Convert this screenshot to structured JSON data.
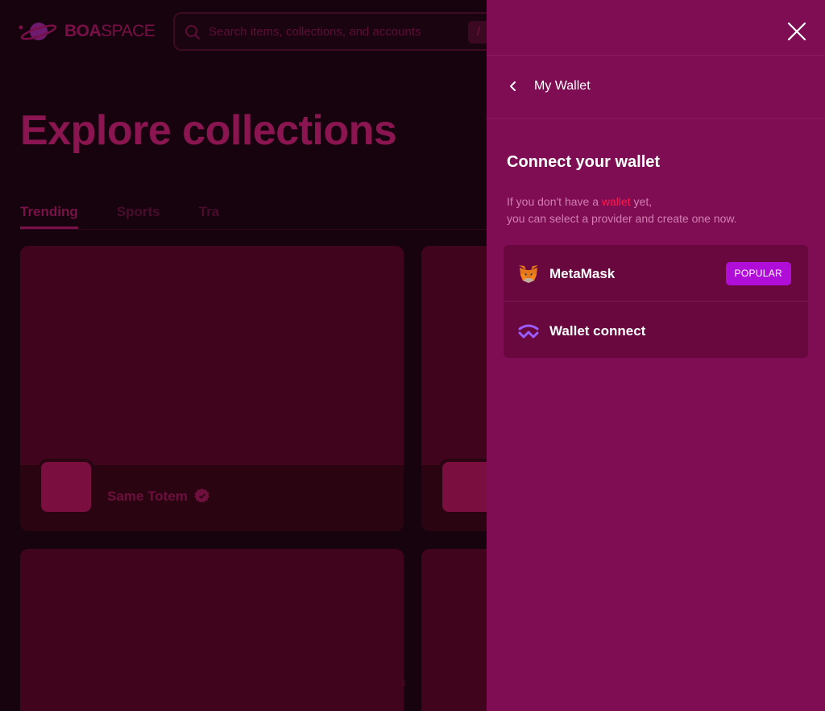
{
  "header": {
    "logo_bold": "BOA",
    "logo_light": "SPACE",
    "search_placeholder": "Search items, collections, and accounts",
    "search_shortcut": "/"
  },
  "main": {
    "title": "Explore collections",
    "tabs": [
      "Trending",
      "Sports",
      "Tra"
    ],
    "active_tab": "Trending",
    "cards": [
      {
        "name": "Same Totem",
        "verified": true
      },
      {
        "name": "",
        "verified": false
      }
    ],
    "footer_fragment": "s"
  },
  "drawer": {
    "header_title": "My Wallet",
    "connect_title": "Connect your wallet",
    "desc_part1": "If you don't have a ",
    "desc_link": "wallet",
    "desc_part2": " yet,",
    "desc_line2": "you can select a provider and create one now.",
    "wallets": [
      {
        "label": "MetaMask",
        "icon": "metamask-fox-icon",
        "badge": "POPULAR"
      },
      {
        "label": "Wallet connect",
        "icon": "walletconnect-icon"
      }
    ]
  },
  "colors": {
    "drawer_bg": "#7f0d54",
    "wallet_list_bg": "#69073f",
    "badge_bg": "#b00ed8",
    "desc_accent": "#ff1a4b"
  }
}
